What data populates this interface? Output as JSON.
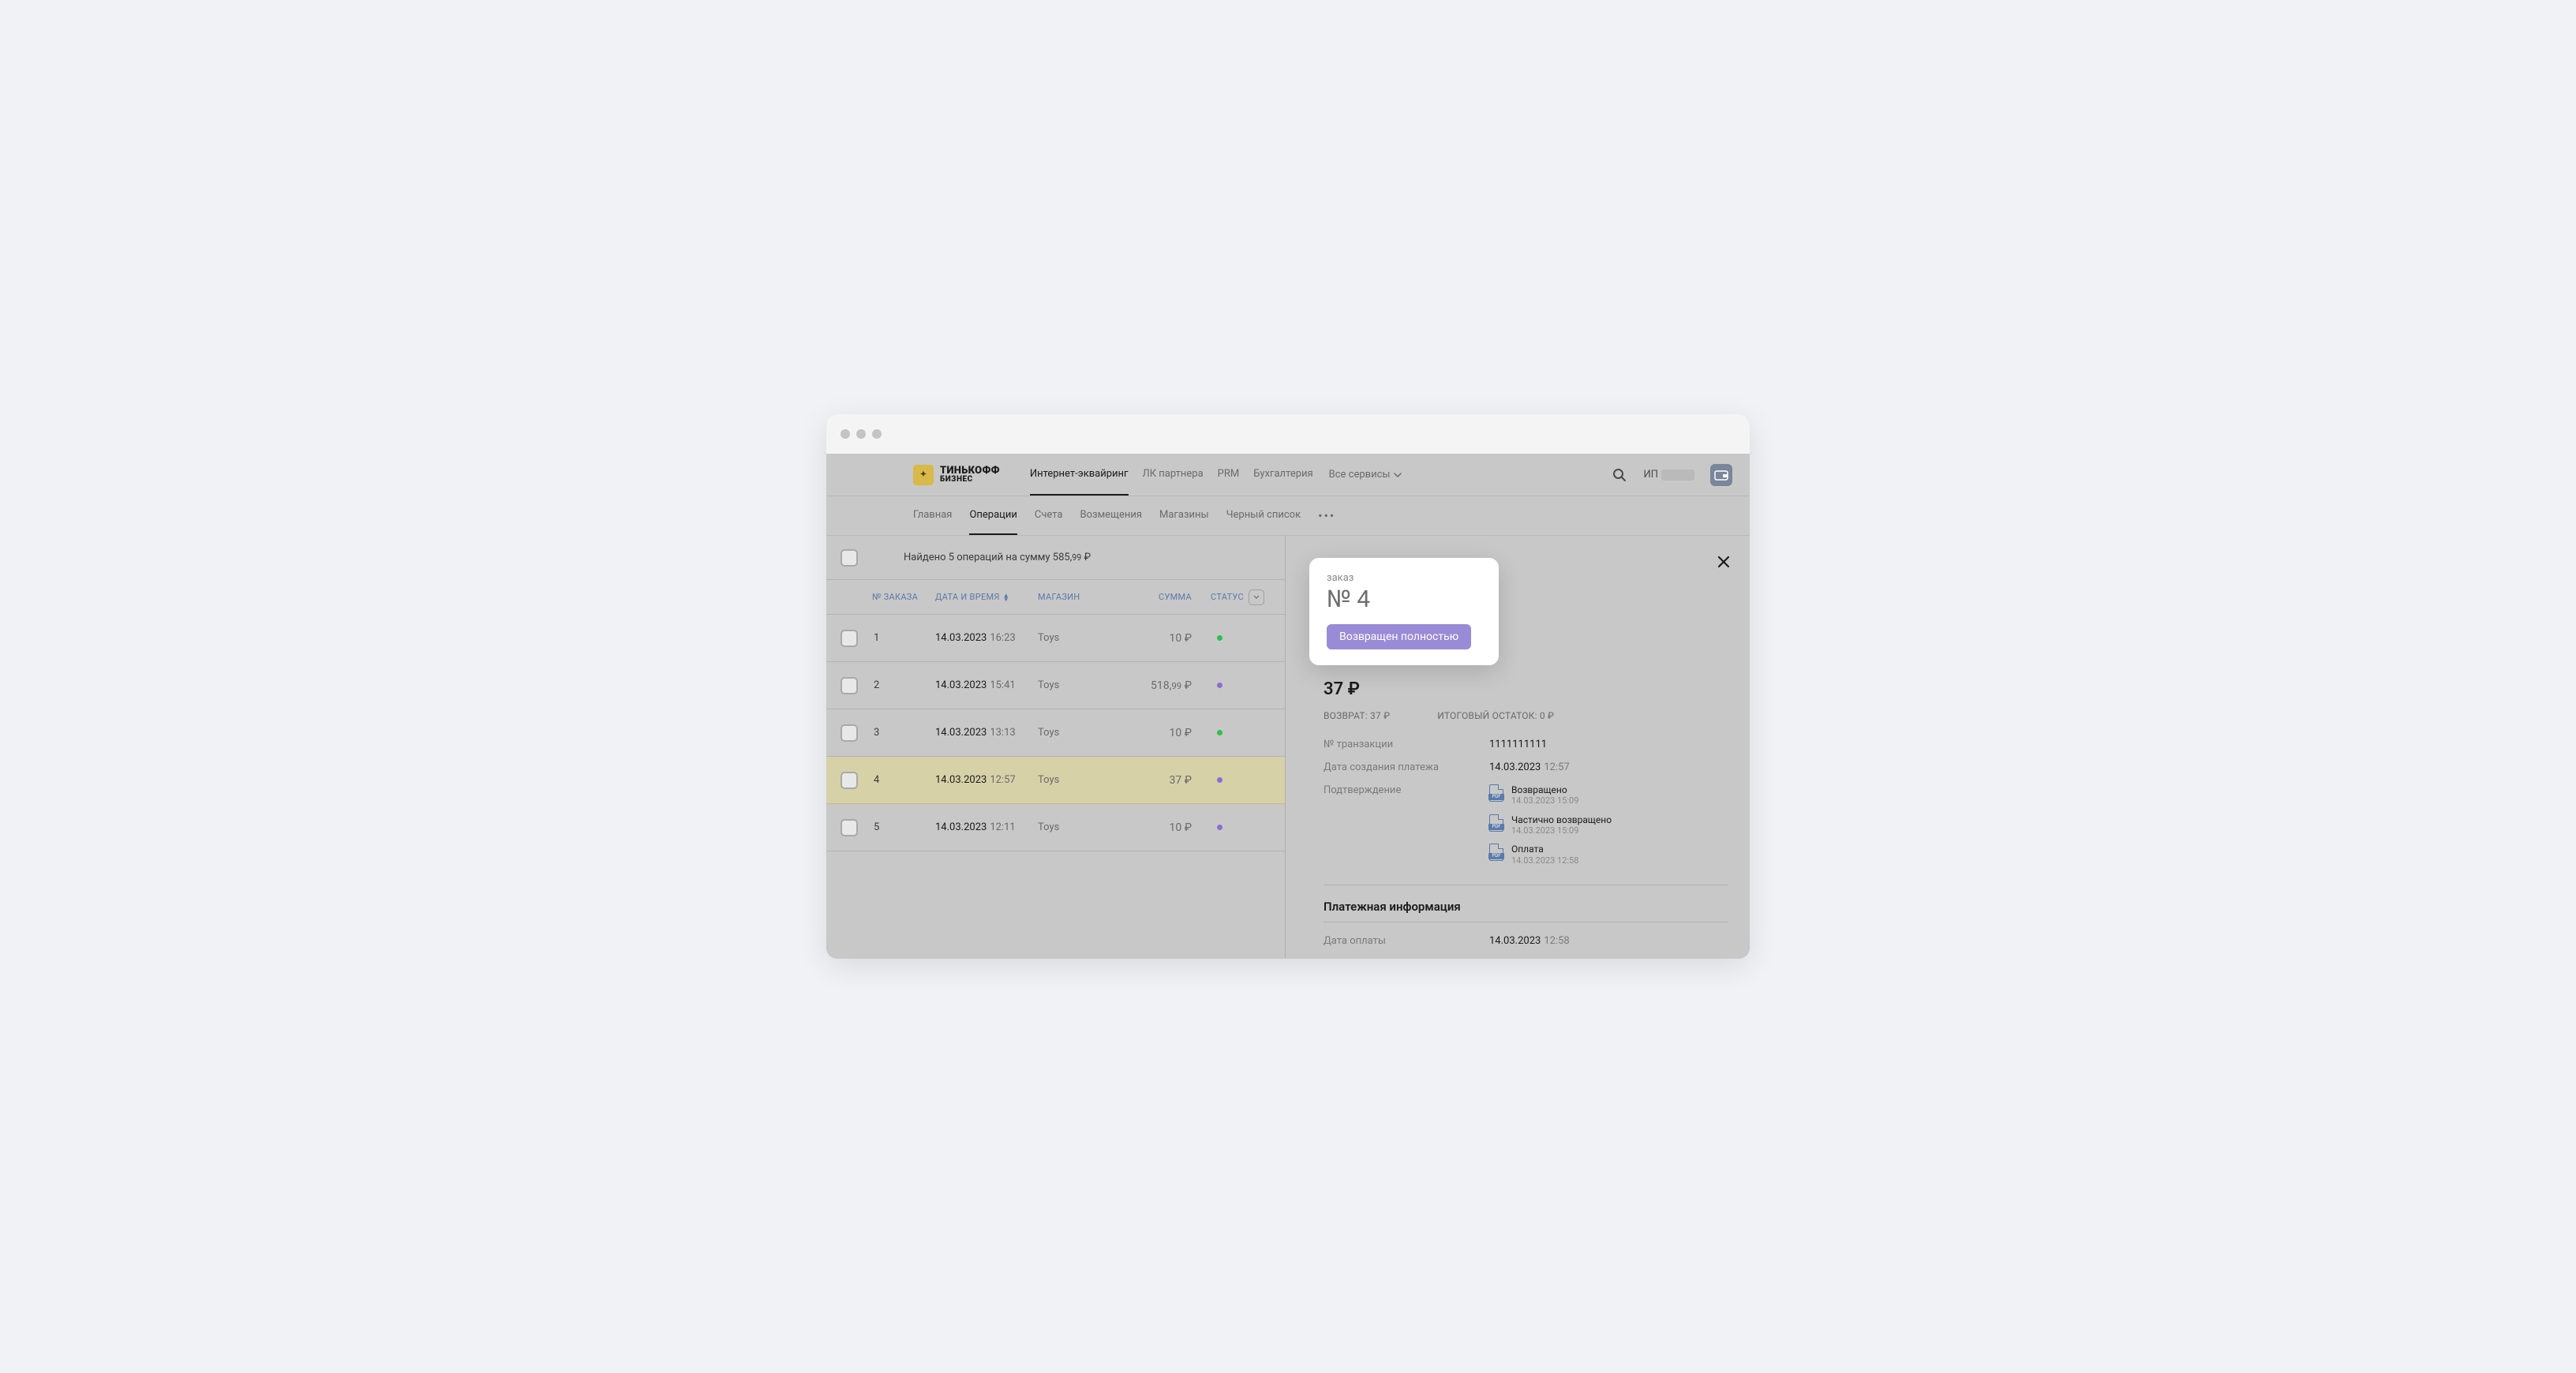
{
  "logo": {
    "line1": "ТИНЬКОФФ",
    "line2": "БИЗНЕС"
  },
  "mainnav": {
    "items": [
      {
        "label": "Интернет-эквайринг",
        "active": true
      },
      {
        "label": "ЛК партнера",
        "active": false
      },
      {
        "label": "PRM",
        "active": false
      },
      {
        "label": "Бухгалтерия",
        "active": false
      }
    ],
    "all_services": "Все сервисы"
  },
  "user_prefix": "ИП",
  "subnav": {
    "items": [
      {
        "label": "Главная",
        "active": false
      },
      {
        "label": "Операции",
        "active": true
      },
      {
        "label": "Счета",
        "active": false
      },
      {
        "label": "Возмещения",
        "active": false
      },
      {
        "label": "Магазины",
        "active": false
      },
      {
        "label": "Черный список",
        "active": false
      }
    ]
  },
  "summary": {
    "prefix": "Найдено 5 операций на сумму 585,",
    "minor": "99",
    "currency": " ₽"
  },
  "columns": {
    "order": "№ ЗАКАЗА",
    "date": "ДАТА И ВРЕМЯ",
    "shop": "МАГАЗИН",
    "sum": "СУММА",
    "status": "СТАТУС"
  },
  "rows": [
    {
      "n": "1",
      "date": "14.03.2023",
      "time": "16:23",
      "shop": "Toys",
      "sum": "10 ₽",
      "dot": "green"
    },
    {
      "n": "2",
      "date": "14.03.2023",
      "time": "15:41",
      "shop": "Toys",
      "sum_pre": "518,",
      "sum_minor": "99",
      "sum_post": " ₽",
      "dot": "purple"
    },
    {
      "n": "3",
      "date": "14.03.2023",
      "time": "13:13",
      "shop": "Toys",
      "sum": "10 ₽",
      "dot": "green"
    },
    {
      "n": "4",
      "date": "14.03.2023",
      "time": "12:57",
      "shop": "Toys",
      "sum": "37 ₽",
      "dot": "purple",
      "selected": true
    },
    {
      "n": "5",
      "date": "14.03.2023",
      "time": "12:11",
      "shop": "Toys",
      "sum": "10 ₽",
      "dot": "purple"
    }
  ],
  "detail": {
    "order_label": "заказ",
    "order_number": "№ 4",
    "badge": "Возвращен полностью",
    "amount": "37 ₽",
    "refund_label": "ВОЗВРАТ: 37 ₽",
    "balance_label": "ИТОГОВЫЙ ОСТАТОК: 0 ₽",
    "txn_label": "№ транзакции",
    "txn_value": "1111111111",
    "created_label": "Дата создания платежа",
    "created_date": "14.03.2023",
    "created_time": "12:57",
    "confirm_label": "Подтверждение",
    "docs": [
      {
        "title": "Возвращено",
        "ts": "14.03.2023 15:09"
      },
      {
        "title": "Частично возвращено",
        "ts": "14.03.2023 15:09"
      },
      {
        "title": "Оплата",
        "ts": "14.03.2023 12:58"
      }
    ],
    "pay_section": "Платежная информация",
    "pay_date_label": "Дата оплаты",
    "pay_date": "14.03.2023",
    "pay_time": "12:58"
  }
}
